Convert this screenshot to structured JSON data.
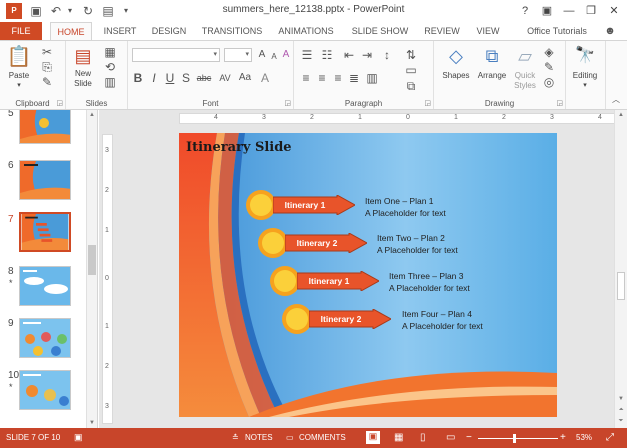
{
  "title_bar": {
    "document_title": "summers_here_12138.pptx - PowerPoint",
    "help": "?",
    "minimize": "—",
    "restore": "❐",
    "close": "✕"
  },
  "tabs": [
    "FILE",
    "HOME",
    "INSERT",
    "DESIGN",
    "TRANSITIONS",
    "ANIMATIONS",
    "SLIDE SHOW",
    "REVIEW",
    "VIEW"
  ],
  "account": "Office Tutorials",
  "ribbon": {
    "clipboard": {
      "label": "Clipboard",
      "paste": "Paste"
    },
    "slides": {
      "label": "Slides",
      "new_slide": "New Slide"
    },
    "font": {
      "label": "Font",
      "bold": "B",
      "italic": "I",
      "underline": "U",
      "strike": "S",
      "shadow": "abc",
      "spacing": "AV",
      "case": "Aa",
      "grow": "A",
      "shrink": "A",
      "clear": "A"
    },
    "paragraph": {
      "label": "Paragraph"
    },
    "drawing": {
      "label": "Drawing",
      "shapes": "Shapes",
      "arrange": "Arrange",
      "quick_styles": "Quick Styles"
    },
    "editing": {
      "label": "Editing"
    }
  },
  "thumbnails": [
    {
      "num": "5",
      "star": ""
    },
    {
      "num": "6",
      "star": ""
    },
    {
      "num": "7",
      "star": ""
    },
    {
      "num": "8",
      "star": "*"
    },
    {
      "num": "9",
      "star": ""
    },
    {
      "num": "10",
      "star": "*"
    }
  ],
  "ruler_labels": [
    "4",
    "3",
    "2",
    "1",
    "0",
    "1",
    "2",
    "3",
    "4"
  ],
  "vruler_labels": [
    "3",
    "2",
    "1",
    "0",
    "1",
    "2",
    "3"
  ],
  "slide": {
    "title": "Itinerary Slide",
    "items": [
      {
        "arrow": "Itinerary 1",
        "heading": "Item One – Plan 1",
        "sub": "A Placeholder for text"
      },
      {
        "arrow": "Itinerary 2",
        "heading": "Item Two – Plan 2",
        "sub": "A Placeholder for text"
      },
      {
        "arrow": "Itinerary 1",
        "heading": "Item Three – Plan 3",
        "sub": "A Placeholder for text"
      },
      {
        "arrow": "Itinerary 2",
        "heading": "Item Four – Plan 4",
        "sub": "A Placeholder for text"
      }
    ]
  },
  "status": {
    "slide_info": "SLIDE 7 OF 10",
    "notes": "NOTES",
    "comments": "COMMENTS",
    "zoom": "53%"
  },
  "colors": {
    "accent": "#c8452a",
    "file_tab": "#d04a24"
  }
}
